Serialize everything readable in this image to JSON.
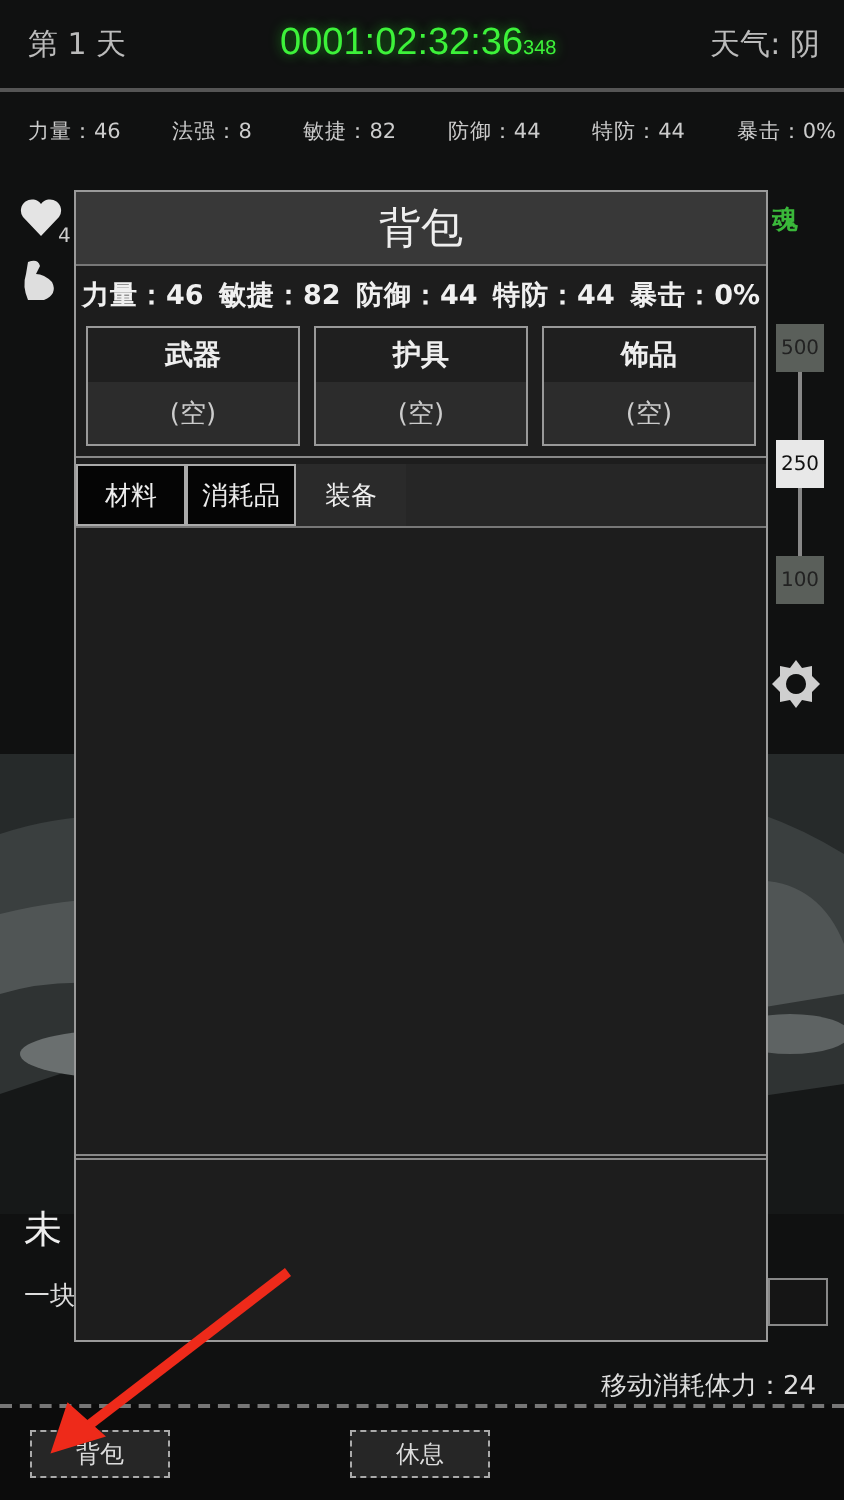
{
  "header": {
    "day": "第 1 天",
    "timer": "0001:02:32:36",
    "timer_ms": "348",
    "weather": "天气: 阴"
  },
  "stats": [
    "力量：46",
    "法强：8",
    "敏捷：82",
    "防御：44",
    "特防：44",
    "暴击：0%"
  ],
  "side": {
    "hp_fragment": "4",
    "status_fragment": "魂"
  },
  "speed": [
    {
      "label": "500",
      "selected": false
    },
    {
      "label": "250",
      "selected": true
    },
    {
      "label": "100",
      "selected": false
    }
  ],
  "location": {
    "name": "未",
    "description": "一块"
  },
  "move_cost": "移动消耗体力：24",
  "bottom_buttons": [
    "背包",
    "休息"
  ],
  "bag": {
    "title": "背包",
    "stats": [
      "力量：46",
      "敏捷：82",
      "防御：44",
      "特防：44",
      "暴击：0%"
    ],
    "slots": [
      {
        "name": "武器",
        "item": "(空)"
      },
      {
        "name": "护具",
        "item": "(空)"
      },
      {
        "name": "饰品",
        "item": "(空)"
      }
    ],
    "tabs": [
      {
        "label": "材料",
        "selected": false
      },
      {
        "label": "消耗品",
        "selected": false
      },
      {
        "label": "装备",
        "selected": true
      }
    ]
  }
}
